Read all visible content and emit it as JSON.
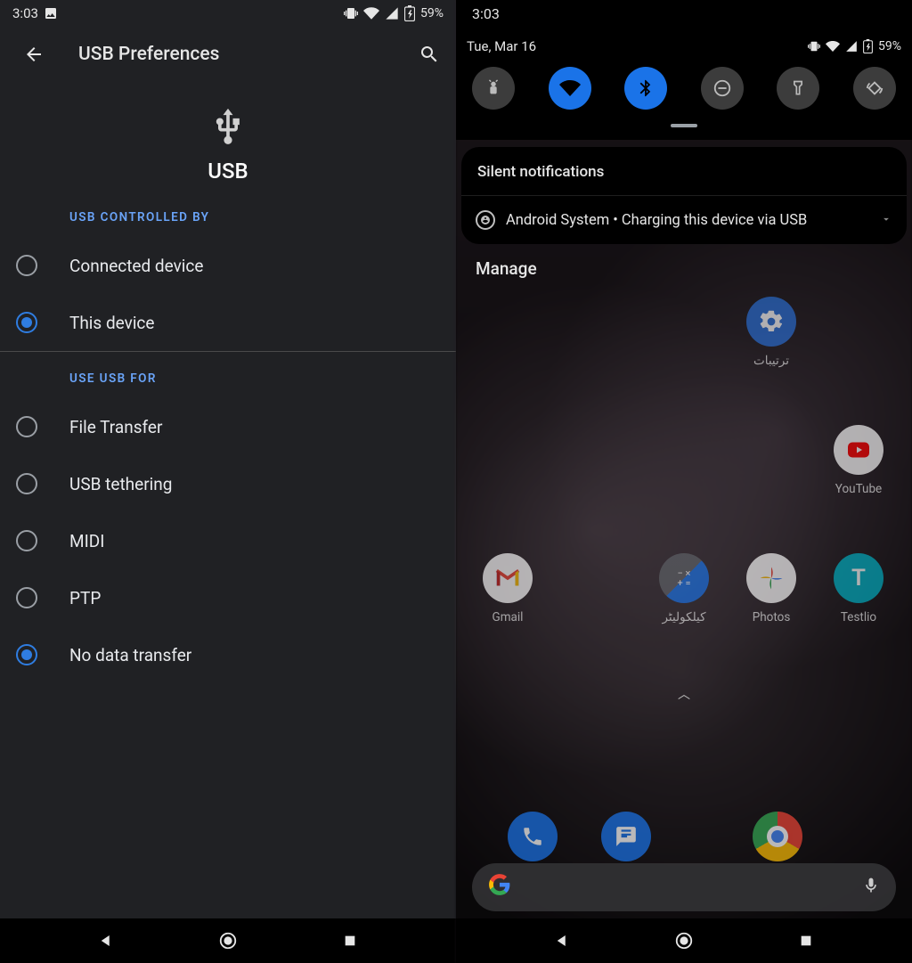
{
  "left": {
    "status": {
      "time": "3:03",
      "battery": "59%"
    },
    "title": "USB Preferences",
    "hero": "USB",
    "section1": {
      "header": "USB CONTROLLED BY",
      "options": [
        "Connected device",
        "This device"
      ],
      "selected": 1
    },
    "section2": {
      "header": "USE USB FOR",
      "options": [
        "File Transfer",
        "USB tethering",
        "MIDI",
        "PTP",
        "No data transfer"
      ],
      "selected": 4
    }
  },
  "right": {
    "status": {
      "time": "3:03",
      "battery": "59%",
      "date": "Tue, Mar 16"
    },
    "qs": {
      "tiles": [
        {
          "name": "android-debug",
          "on": false
        },
        {
          "name": "wifi",
          "on": true
        },
        {
          "name": "bluetooth",
          "on": true
        },
        {
          "name": "dnd",
          "on": false
        },
        {
          "name": "flashlight",
          "on": false
        },
        {
          "name": "auto-rotate",
          "on": false
        }
      ]
    },
    "notif": {
      "header": "Silent notifications",
      "item": "Android System • Charging this device via USB"
    },
    "manage": "Manage",
    "apps": {
      "settings": "ترتیبات",
      "youtube": "YouTube",
      "gmail": "Gmail",
      "calculator": "کیلکولیٹر",
      "photos": "Photos",
      "testlio": "Testlio"
    }
  }
}
